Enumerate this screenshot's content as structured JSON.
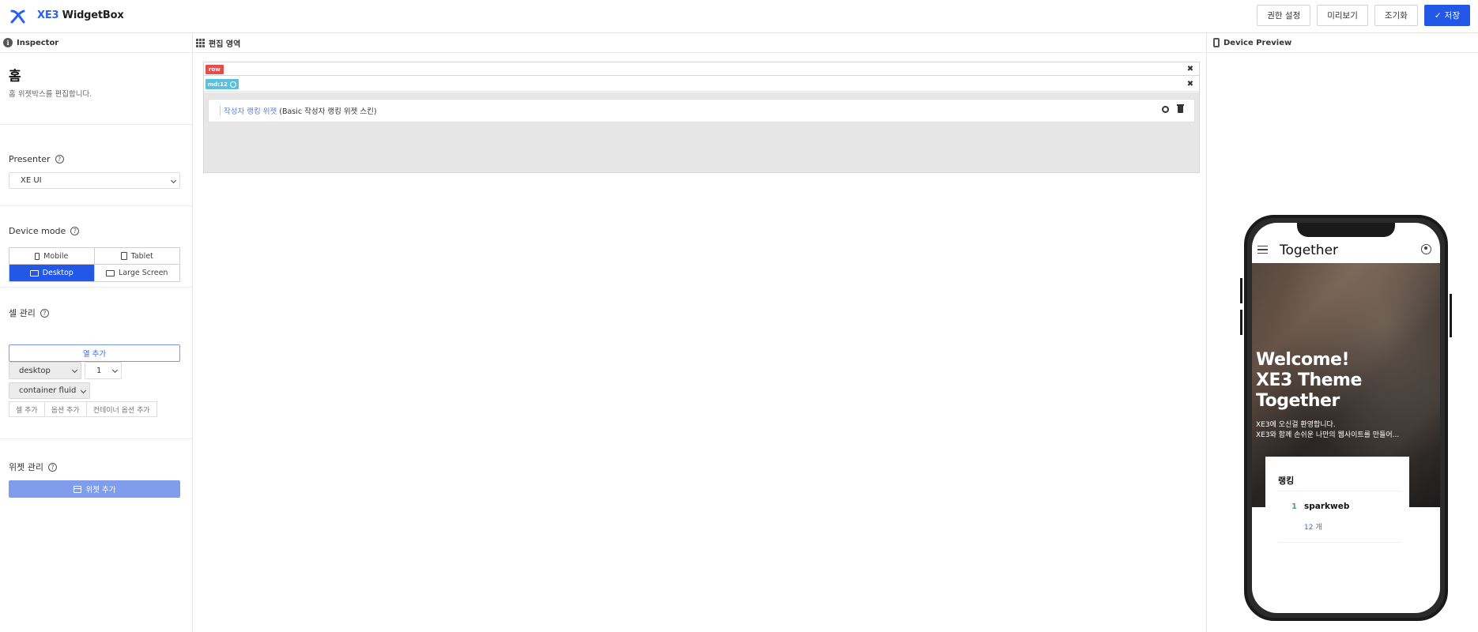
{
  "header": {
    "brand_prefix": "XE3",
    "brand_suffix": " WidgetBox",
    "buttons": [
      "권한 설정",
      "미리보기",
      "조기화",
      "저장"
    ]
  },
  "inspector": {
    "title": "Inspector",
    "page_title": "홈",
    "page_desc": "홈 위젯박스를 편집합니다.",
    "presenter_label": "Presenter",
    "presenter_value": "XE UI",
    "device_mode_label": "Device mode",
    "modes": [
      "Mobile",
      "Tablet",
      "Desktop",
      "Large Screen"
    ],
    "active_mode": "Desktop",
    "cell_label": "셀 관리",
    "add_column": "열 추가",
    "device_select": "desktop",
    "count_select": "1",
    "container_select": "container fluid",
    "mini_buttons": [
      "셀 추가",
      "옵션 추가",
      "컨테이너 옵션 추가"
    ],
    "widget_label": "위젯 관리",
    "add_widget": "위젯 추가"
  },
  "editor": {
    "title": "편집 영역",
    "row_tag": "row",
    "col_tag": "md:12",
    "widget_name": "작성자 랭킹 위젯",
    "widget_skin": "(Basic 작성자 랭킹 위젯 스킨)"
  },
  "preview": {
    "title": "Device Preview",
    "app_title": "Together",
    "hero_title_1": "Welcome!",
    "hero_title_2": "XE3 Theme",
    "hero_title_3": "Together",
    "hero_sub_1": "XE3에 오신걸 환영합니다.",
    "hero_sub_2": "XE3와 함께 손쉬운 나만의 웹사이트를 만들어...",
    "rank_title": "랭킹",
    "rank_num": "1",
    "rank_name": "sparkweb",
    "rank_count": "12 개"
  },
  "colors": {
    "accent": "#2357e6",
    "row_tag": "#e64d4d",
    "col_tag": "#5bc0de",
    "rank_green": "#37b24d"
  }
}
